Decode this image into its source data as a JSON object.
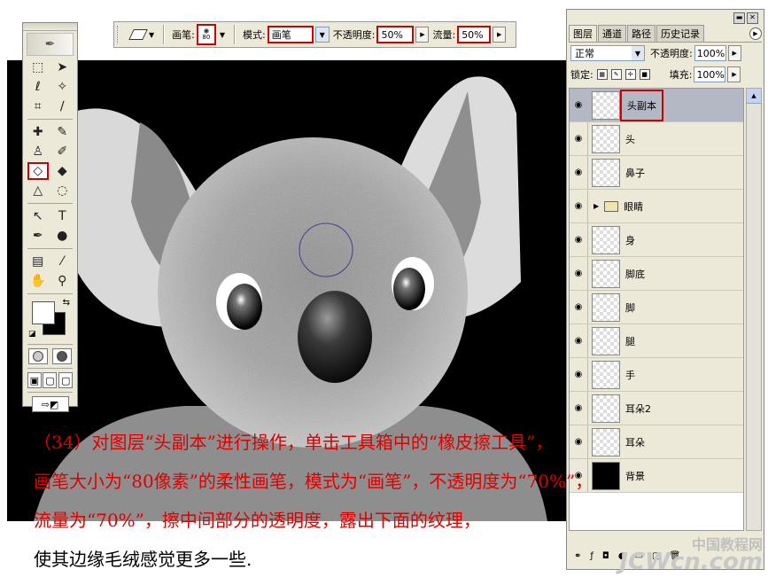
{
  "options_bar": {
    "brush_label": "画笔:",
    "brush_size": "80",
    "mode_label": "模式:",
    "mode_value": "画笔",
    "opacity_label": "不透明度:",
    "opacity_value": "50%",
    "flow_label": "流量:",
    "flow_value": "50%"
  },
  "layers_panel": {
    "tabs": [
      "图层",
      "通道",
      "路径",
      "历史记录"
    ],
    "blend_mode": "正常",
    "opacity_label": "不透明度:",
    "opacity_value": "100%",
    "lock_label": "锁定:",
    "fill_label": "填充:",
    "fill_value": "100%",
    "layers": [
      {
        "name": "头副本",
        "selected": true
      },
      {
        "name": "头"
      },
      {
        "name": "鼻子"
      },
      {
        "name": "眼睛",
        "group": true
      },
      {
        "name": "身"
      },
      {
        "name": "脚底"
      },
      {
        "name": "脚"
      },
      {
        "name": "腿"
      },
      {
        "name": "手"
      },
      {
        "name": "耳朵2"
      },
      {
        "name": "耳朵"
      },
      {
        "name": "背景"
      }
    ]
  },
  "caption": {
    "line1": "（34）对图层“头副本”进行操作，单击工具箱中的“橡皮擦工具”，",
    "line2": "画笔大小为“80像素”的柔性画笔，模式为“画笔”，不透明度为“70%”，",
    "line3": "流量为“70%”，擦中间部分的透明度，露出下面的纹理，",
    "line4": "使其边缘毛绒感觉更多一些."
  },
  "watermark": {
    "line1": "中国教程网",
    "line2": "JCWcn.com"
  },
  "colors": {
    "highlight": "#d00000",
    "caption": "#e00000",
    "canvas_bg": "#000000"
  }
}
